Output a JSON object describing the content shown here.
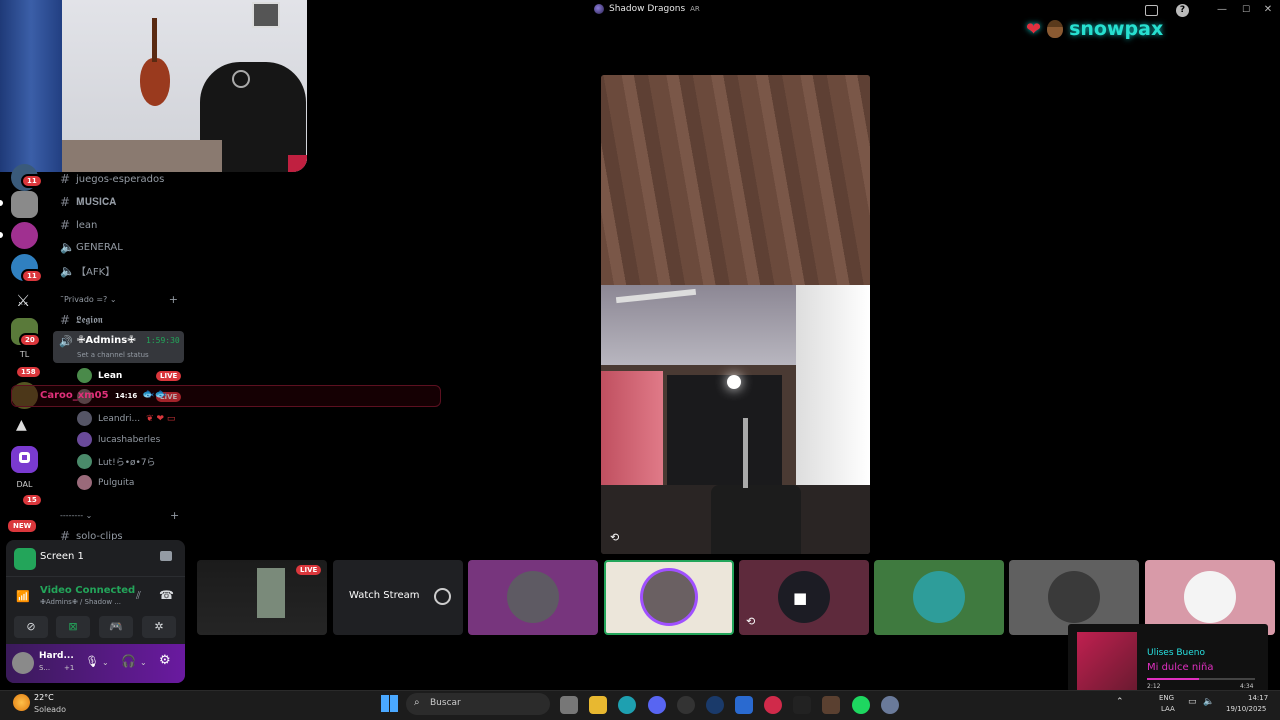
{
  "window": {
    "title": "Shadow Dragons",
    "title_suffix": "AR"
  },
  "overlay_brand": {
    "name": "snowpax"
  },
  "servers": [
    {
      "badge": "11"
    },
    {
      "badge": ""
    },
    {
      "badge": ""
    },
    {
      "badge": "11"
    },
    {
      "badge": ""
    },
    {
      "badge": "20"
    },
    {
      "badge": "158"
    },
    {
      "badge": ""
    },
    {
      "badge": ""
    },
    {
      "badge": ""
    },
    {
      "badge": "15"
    },
    {
      "badge": "NEW"
    }
  ],
  "channels": {
    "top": [
      {
        "name": "juegos-esperados",
        "icon": "hash"
      },
      {
        "name": "𝐌𝐔𝐒𝐈𝐂𝐀",
        "icon": "hash"
      },
      {
        "name": "lean",
        "icon": "hash"
      },
      {
        "name": "GENERAL",
        "icon": "speaker"
      },
      {
        "name": "【AFK】",
        "icon": "speaker"
      }
    ],
    "private_category": "˜Privado =?",
    "legion": "𝕷𝖊𝖌𝖎𝖔𝖓",
    "voice": {
      "name": "✙Admins✙",
      "timer": "1:59:30",
      "status_placeholder": "Set a channel status",
      "users": [
        {
          "name": "Lean",
          "live": "LIVE"
        },
        {
          "name": "",
          "live": "LIVE"
        },
        {
          "name": "Leandri...",
          "live": ""
        },
        {
          "name": "lucashaberles",
          "live": ""
        },
        {
          "name": "Lut!ら•ø•7ら",
          "live": ""
        },
        {
          "name": "Pulguita",
          "live": ""
        }
      ]
    },
    "category2": "--------",
    "solo_clips": "solo-clips"
  },
  "overlay_notification": {
    "user": "Caroo_xm05",
    "time": "14:16"
  },
  "panel": {
    "screen_label": "Screen 1",
    "video_status": "Video Connected",
    "video_channel": "✙Admins✙ / Shadow ...",
    "user_name": "Hard...",
    "user_sub": "S...",
    "user_extra": "+1"
  },
  "stage": {
    "live_badge": "LIVE",
    "watch_stream": "Watch Stream"
  },
  "music": {
    "artist": "Ulises Bueno",
    "song": "Mi dulce niña",
    "elapsed": "2:12",
    "total": "4:34",
    "progress": 0.48
  },
  "taskbar": {
    "weather_temp": "22°C",
    "weather_desc": "Soleado",
    "search_placeholder": "Buscar",
    "lang1": "ENG",
    "lang2": "LAA",
    "time": "14:17",
    "date": "19/10/2025"
  },
  "colors": {
    "accent_live": "#da373c",
    "voice_green": "#23a55a",
    "brand_cyan": "#27e0d0"
  }
}
